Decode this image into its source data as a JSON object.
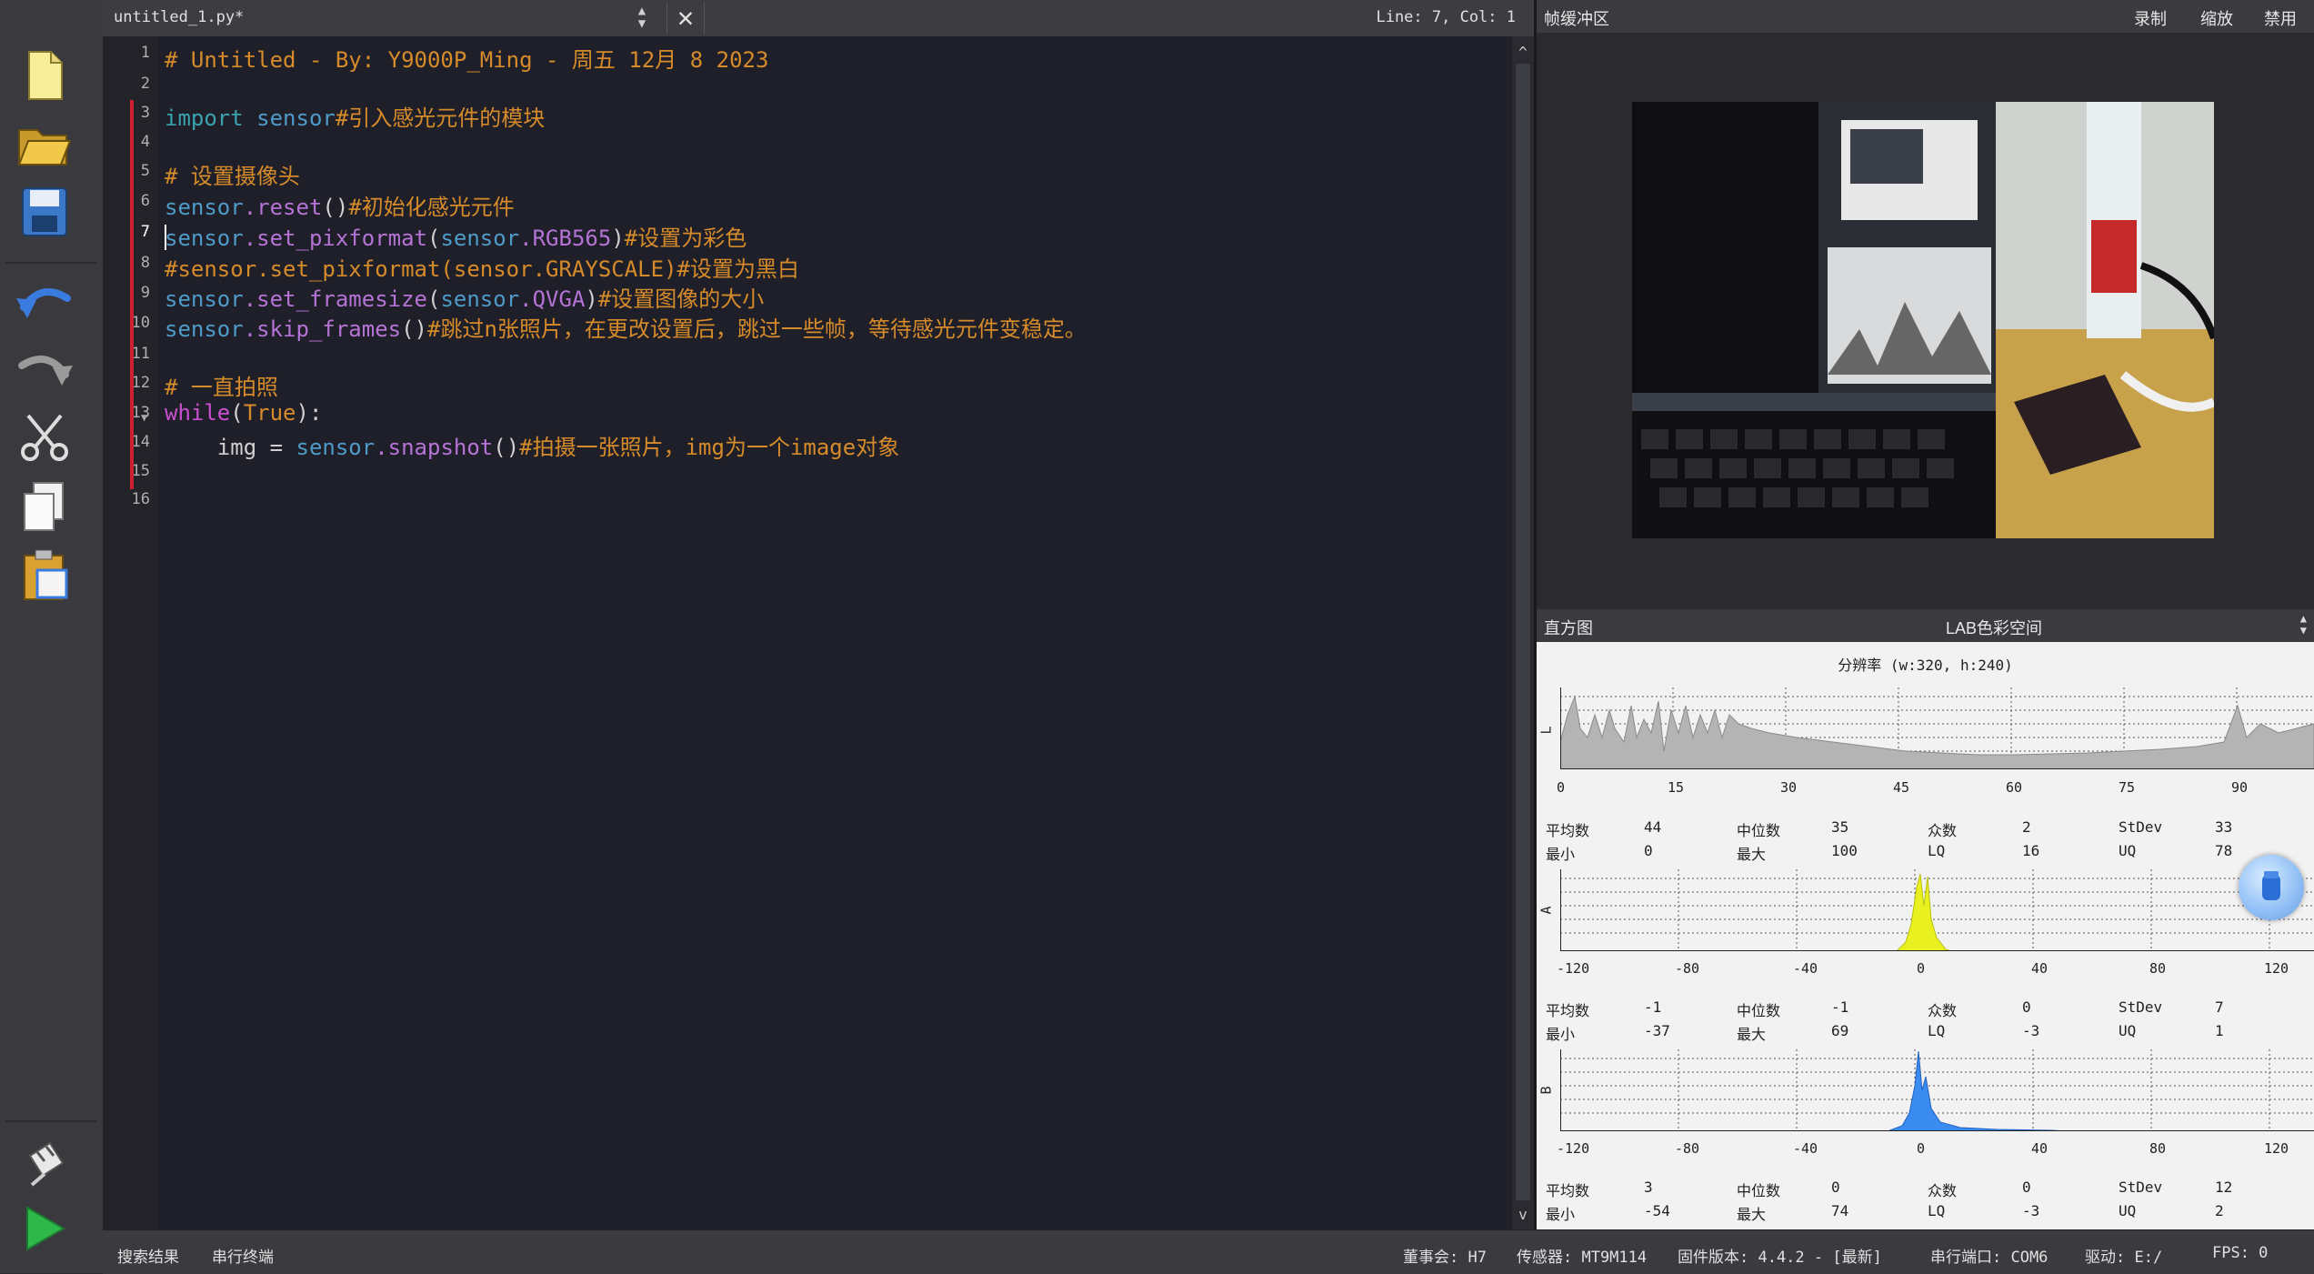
{
  "toolbar": {
    "buttons": [
      "new-file-icon",
      "open-folder-icon",
      "save-icon",
      "undo-icon",
      "redo-icon",
      "cut-icon",
      "copy-icon",
      "paste-icon",
      "connect-icon",
      "run-icon"
    ]
  },
  "editor": {
    "tab_name": "untitled_1.py*",
    "cursor_position": "Line: 7, Col: 1",
    "line_numbers": [
      "1",
      "2",
      "3",
      "4",
      "5",
      "6",
      "7",
      "8",
      "9",
      "10",
      "11",
      "12",
      "13",
      "14",
      "15",
      "16"
    ],
    "lines": {
      "l1": "# Untitled - By: Y9000P_Ming - 周五 12月 8 2023",
      "l3_kw": "import",
      "l3_mod": " sensor",
      "l3_cm": "#引入感光元件的模块",
      "l5": "# 设置摄像头",
      "l6_mod": "sensor",
      "l6_fn": ".reset",
      "l6_pn": "()",
      "l6_cm": "#初始化感光元件",
      "l7_mod": "sensor",
      "l7_fn": ".set_pixformat",
      "l7_p1": "(",
      "l7_arg_mod": "sensor",
      "l7_arg_fn": ".RGB565",
      "l7_p2": ")",
      "l7_cm": "#设置为彩色",
      "l8": "#sensor.set_pixformat(sensor.GRAYSCALE)#设置为黑白",
      "l9_mod": "sensor",
      "l9_fn": ".set_framesize",
      "l9_p1": "(",
      "l9_arg_mod": "sensor",
      "l9_arg_fn": ".QVGA",
      "l9_p2": ")",
      "l9_cm": "#设置图像的大小",
      "l10_mod": "sensor",
      "l10_fn": ".skip_frames",
      "l10_pn": "()",
      "l10_cm": "#跳过n张照片，在更改设置后，跳过一些帧，等待感光元件变稳定。",
      "l12": "# 一直拍照",
      "l13_wh": "while",
      "l13_p1": "(",
      "l13_tr": "True",
      "l13_p2": "):",
      "l14_var": "    img = ",
      "l14_mod": "sensor",
      "l14_fn": ".snapshot",
      "l14_pn": "()",
      "l14_cm": "#拍摄一张照片，img为一个image对象"
    }
  },
  "framebuffer": {
    "title": "帧缓冲区",
    "actions": [
      "录制",
      "缩放",
      "禁用"
    ]
  },
  "histogram": {
    "title": "直方图",
    "colorspace": "LAB色彩空间",
    "resolution": "分辨率 (w:320, h:240)",
    "channels": [
      {
        "label": "L",
        "ticks": [
          "0",
          "15",
          "30",
          "45",
          "60",
          "75",
          "90"
        ],
        "stats": {
          "mean_label": "平均数",
          "mean": "44",
          "median_label": "中位数",
          "median": "35",
          "mode_label": "众数",
          "mode": "2",
          "stdev_label": "StDev",
          "stdev": "33",
          "min_label": "最小",
          "min": "0",
          "max_label": "最大",
          "max": "100",
          "lq_label": "LQ",
          "lq": "16",
          "uq_label": "UQ",
          "uq": "78"
        }
      },
      {
        "label": "A",
        "ticks": [
          "-120",
          "-80",
          "-40",
          "0",
          "40",
          "80",
          "120"
        ],
        "stats": {
          "mean_label": "平均数",
          "mean": "-1",
          "median_label": "中位数",
          "median": "-1",
          "mode_label": "众数",
          "mode": "0",
          "stdev_label": "StDev",
          "stdev": "7",
          "min_label": "最小",
          "min": "-37",
          "max_label": "最大",
          "max": "69",
          "lq_label": "LQ",
          "lq": "-3",
          "uq_label": "UQ",
          "uq": "1"
        }
      },
      {
        "label": "B",
        "ticks": [
          "-120",
          "-80",
          "-40",
          "0",
          "40",
          "80",
          "120"
        ],
        "stats": {
          "mean_label": "平均数",
          "mean": "3",
          "median_label": "中位数",
          "median": "0",
          "mode_label": "众数",
          "mode": "0",
          "stdev_label": "StDev",
          "stdev": "12",
          "min_label": "最小",
          "min": "-54",
          "max_label": "最大",
          "max": "74",
          "lq_label": "LQ",
          "lq": "-3",
          "uq_label": "UQ",
          "uq": "2"
        }
      }
    ]
  },
  "statusbar": {
    "tab_search": "搜索结果",
    "tab_serial": "串行终端",
    "board": "董事会: H7",
    "sensor": "传感器: MT9M114",
    "firmware": "固件版本: 4.4.2 - [最新]",
    "port": "串行端口: COM6",
    "drive": "驱动: E:/",
    "fps": "FPS: 0"
  }
}
